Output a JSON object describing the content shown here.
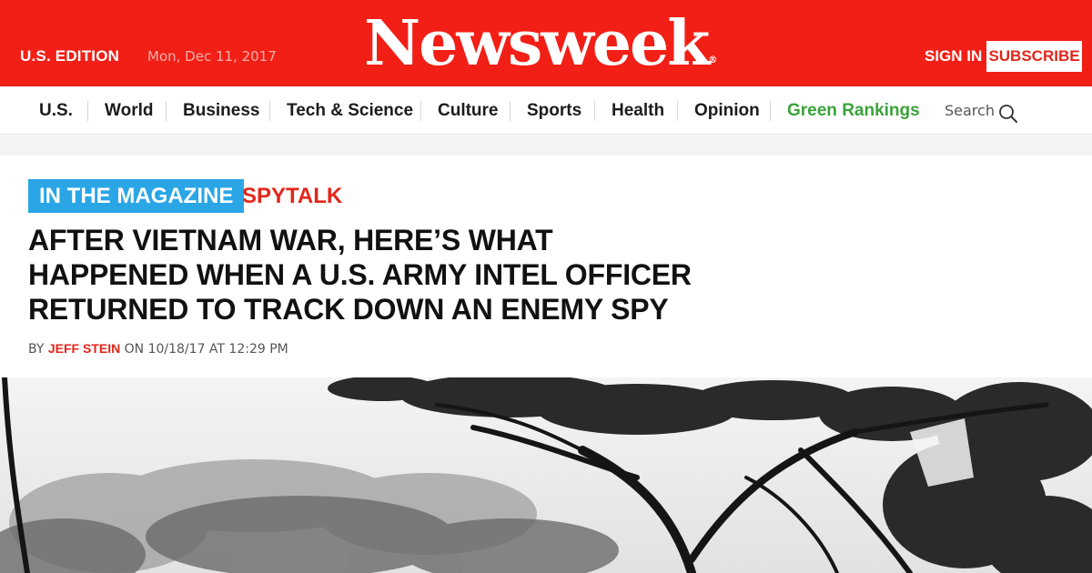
{
  "header": {
    "edition": "U.S. EDITION",
    "date": "Mon, Dec 11, 2017",
    "logo": "Newsweek",
    "sign_in": "SIGN IN",
    "subscribe": "SUBSCRIBE",
    "brand_color": "#f21f16"
  },
  "nav": {
    "items": [
      {
        "label": "U.S."
      },
      {
        "label": "World"
      },
      {
        "label": "Business"
      },
      {
        "label": "Tech & Science"
      },
      {
        "label": "Culture"
      },
      {
        "label": "Sports"
      },
      {
        "label": "Health"
      },
      {
        "label": "Opinion"
      },
      {
        "label": "Green Rankings"
      }
    ],
    "search_label": "Search",
    "search_icon": "search-icon",
    "highlight_color": "#3aa33a"
  },
  "article": {
    "kicker_magazine": "IN THE MAGAZINE",
    "kicker_section": "SPYTALK",
    "headline_lines": [
      "AFTER VIETNAM WAR, HERE’S WHAT",
      "HAPPENED WHEN A U.S. ARMY INTEL OFFICER",
      "RETURNED TO TRACK DOWN AN ENEMY SPY"
    ],
    "byline_prefix": "BY",
    "author": "JEFF STEIN",
    "byline_suffix": "ON 10/18/17 AT 12:29 PM",
    "kicker_color": "#2aa6e6",
    "accent_color": "#e3261b"
  }
}
